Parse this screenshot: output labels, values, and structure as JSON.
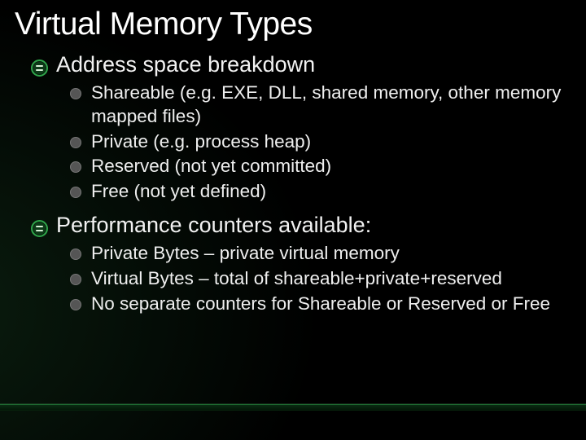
{
  "title": "Virtual Memory Types",
  "sections": [
    {
      "heading": "Address space breakdown",
      "items": [
        "Shareable (e.g. EXE, DLL, shared memory, other memory mapped files)",
        "Private (e.g. process heap)",
        "Reserved (not yet committed)",
        "Free (not yet defined)"
      ]
    },
    {
      "heading": "Performance counters available:",
      "items": [
        "Private Bytes – private virtual memory",
        "Virtual Bytes – total of shareable+private+reserved",
        "No separate counters for Shareable or Reserved or Free"
      ]
    }
  ]
}
